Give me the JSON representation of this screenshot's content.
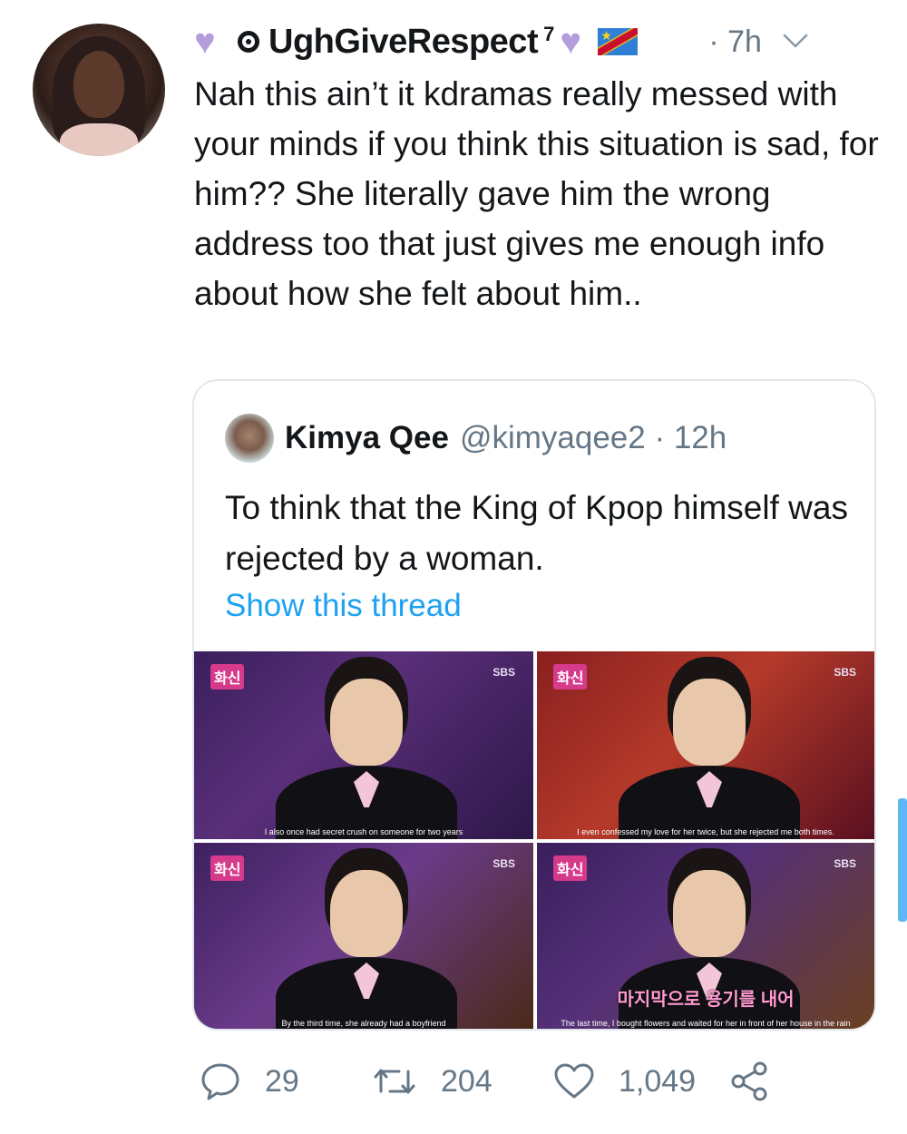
{
  "author": {
    "display_name": "UghGiveRespect",
    "superscript": "7",
    "timestamp": "· 7h",
    "heart_glyph": "♥",
    "heart_color": "#b39ddb",
    "flag_icon": "dr-congo-flag"
  },
  "tweet": {
    "text": "Nah this ain’t it kdramas really messed with your minds if you think this situation is sad, for him?? She literally gave him the wrong address too that just gives me enough info about how she felt about him.."
  },
  "quoted": {
    "display_name": "Kimya Qee",
    "handle_and_time": "@kimyaqee2 · 12h",
    "text": "To think that the King of Kpop himself was rejected by a woman.",
    "link_label": "Show this thread",
    "link_color": "#1da1f2",
    "photos": [
      {
        "logo": "화신",
        "network": "SBS",
        "caption": "I also once had secret crush on someone for two years",
        "overlay": ""
      },
      {
        "logo": "화신",
        "network": "SBS",
        "caption": "I even confessed my love for her twice, but she rejected me both times.",
        "overlay": ""
      },
      {
        "logo": "화신",
        "network": "SBS",
        "caption": "By the third time, she already had a boyfriend",
        "overlay": ""
      },
      {
        "logo": "화신",
        "network": "SBS",
        "caption": "The last time, I bought flowers and waited for her in front of her house in the rain",
        "overlay": "마지막으로 용기를 내어"
      }
    ]
  },
  "actions": {
    "replies": "29",
    "retweets": "204",
    "likes": "1,049",
    "icon_color": "#657786"
  },
  "scrollbar_color": "#5bb8f5"
}
